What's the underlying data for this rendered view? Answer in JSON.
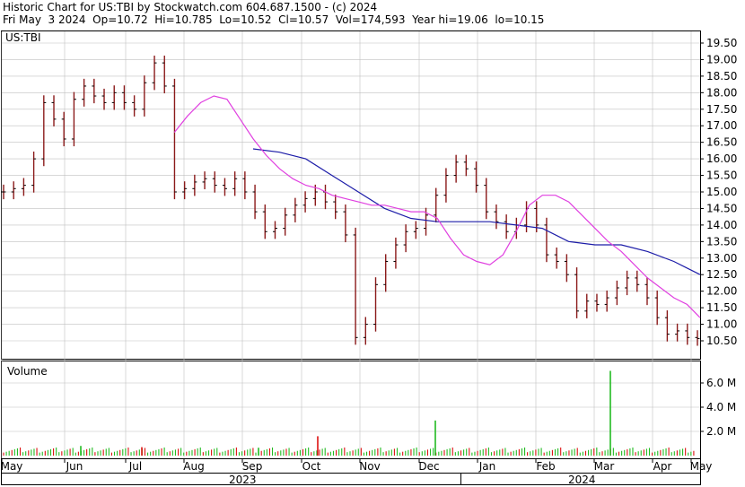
{
  "header": {
    "line1": "Historic Chart for US:TBI by Stockwatch.com 604.687.1500 - (c) 2024",
    "line2": "Fri May  3 2024  Op=10.72  Hi=10.785  Lo=10.52  Cl=10.57  Vol=174,593  Year hi=19.06  lo=10.15"
  },
  "price_panel": {
    "symbol_label": "US:TBI"
  },
  "volume_panel": {
    "label": "Volume"
  },
  "colors": {
    "bar": "#8b1a1a",
    "ma_short": "#e040e0",
    "ma_long": "#1c1ca8",
    "vol_up": "#22bb22",
    "vol_down": "#dd1111",
    "grid": "#c0c0c0"
  },
  "chart_data": [
    {
      "type": "ohlc",
      "title": "",
      "ylim": [
        10.0,
        19.7
      ],
      "y_ticks": [
        "10.50",
        "11.00",
        "11.50",
        "12.00",
        "12.50",
        "13.00",
        "13.50",
        "14.00",
        "14.50",
        "15.00",
        "15.50",
        "16.00",
        "16.50",
        "17.00",
        "17.50",
        "18.00",
        "18.50",
        "19.00",
        "19.50"
      ],
      "x_months": [
        "May",
        "Jun",
        "Jul",
        "Aug",
        "Sep",
        "Oct",
        "Nov",
        "Dec",
        "Jan",
        "Feb",
        "Mar",
        "Apr",
        "May"
      ],
      "x_years": [
        "2023",
        "2024"
      ],
      "closes_weekly": [
        15.0,
        15.1,
        15.2,
        16.0,
        17.7,
        17.2,
        16.6,
        17.8,
        18.2,
        17.9,
        17.7,
        18.0,
        17.7,
        17.5,
        18.3,
        18.9,
        18.2,
        15.0,
        15.1,
        15.3,
        15.4,
        15.2,
        15.1,
        15.4,
        15.0,
        14.4,
        13.8,
        13.9,
        14.3,
        14.6,
        14.8,
        15.0,
        14.7,
        14.4,
        13.7,
        10.6,
        11.0,
        12.2,
        12.9,
        13.4,
        13.8,
        13.9,
        14.3,
        14.9,
        15.5,
        15.9,
        15.7,
        15.2,
        14.4,
        14.1,
        13.8,
        14.0,
        14.5,
        14.0,
        13.1,
        12.9,
        12.5,
        11.4,
        11.7,
        11.6,
        11.8,
        12.1,
        12.4,
        12.2,
        11.8,
        11.2,
        10.7,
        10.8,
        10.6,
        10.57
      ],
      "series": [
        {
          "name": "MA short",
          "values": [
            null,
            null,
            null,
            null,
            null,
            null,
            null,
            null,
            null,
            null,
            null,
            null,
            null,
            16.8,
            17.3,
            17.7,
            17.9,
            17.8,
            17.2,
            16.6,
            16.1,
            15.7,
            15.4,
            15.2,
            15.1,
            14.9,
            14.8,
            14.7,
            14.6,
            14.6,
            14.5,
            14.4,
            14.4,
            14.2,
            13.6,
            13.1,
            12.9,
            12.8,
            13.1,
            13.8,
            14.6,
            14.9,
            14.9,
            14.7,
            14.3,
            13.9,
            13.5,
            13.2,
            12.8,
            12.4,
            12.1,
            11.8,
            11.6,
            11.2
          ]
        },
        {
          "name": "MA long",
          "values": [
            16.3,
            16.2,
            16.0,
            15.5,
            15.0,
            14.5,
            14.2,
            14.1,
            14.1,
            14.1,
            14.0,
            13.9,
            13.5,
            13.4,
            13.4,
            13.2,
            12.9,
            12.5
          ]
        }
      ]
    },
    {
      "type": "bar",
      "title": "Volume",
      "ylim": [
        0,
        7500000
      ],
      "y_ticks": [
        "2.0 M",
        "4.0 M",
        "6.0 M"
      ],
      "spikes": [
        {
          "month": "Jun",
          "value": 800000,
          "direction": "up"
        },
        {
          "month": "Jul",
          "value": 700000,
          "direction": "down"
        },
        {
          "month": "Sep",
          "value": 650000,
          "direction": "up"
        },
        {
          "month": "Oct",
          "value": 1600000,
          "direction": "down"
        },
        {
          "month": "Dec",
          "value": 2900000,
          "direction": "up"
        },
        {
          "month": "Mar",
          "value": 7000000,
          "direction": "up"
        }
      ]
    }
  ]
}
